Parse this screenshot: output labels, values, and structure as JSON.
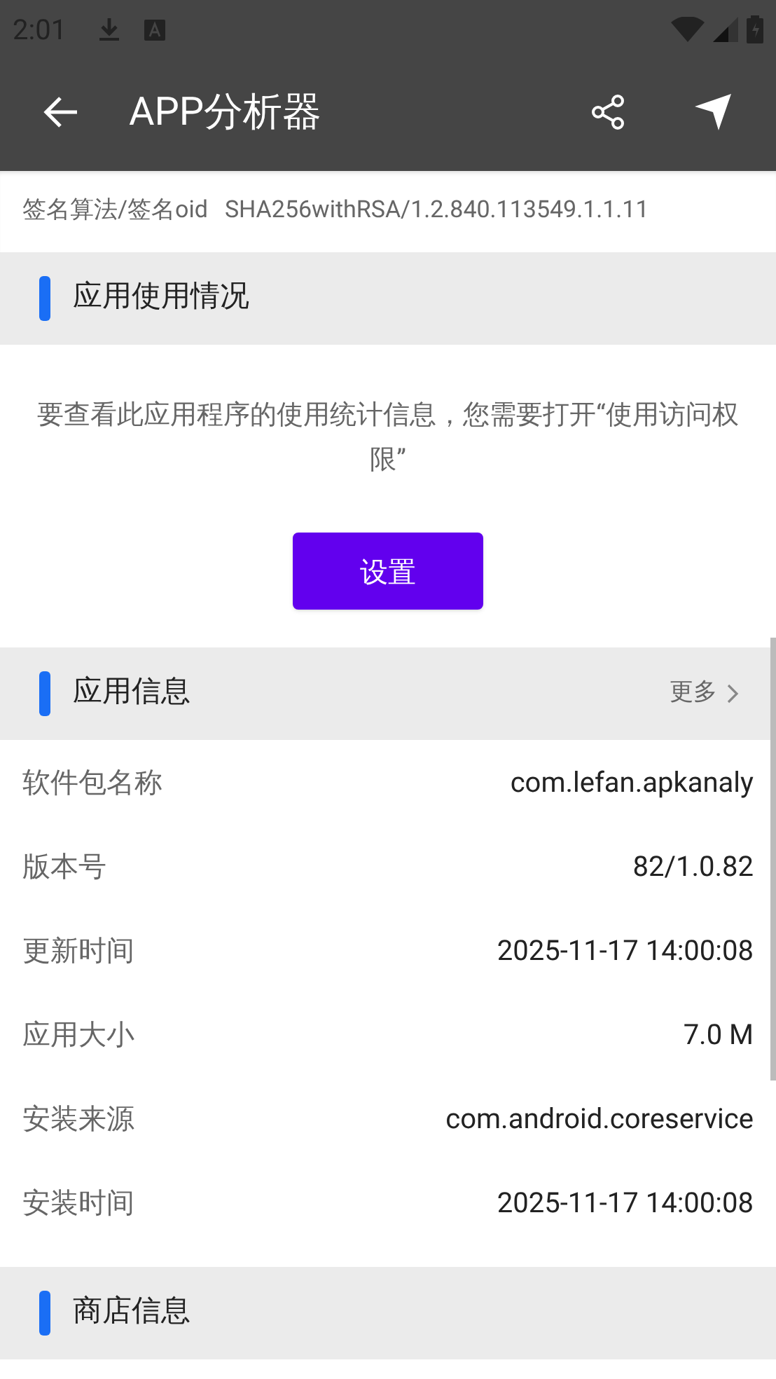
{
  "status_bar": {
    "time": "2:01"
  },
  "app_bar": {
    "title": "APP分析器"
  },
  "signature": {
    "label": "签名算法/签名oid",
    "value": "SHA256withRSA/1.2.840.113549.1.1.11"
  },
  "usage_section": {
    "title": "应用使用情况",
    "message": "要查看此应用程序的使用统计信息，您需要打开“使用访问权限”",
    "button": "设置"
  },
  "info_section": {
    "title": "应用信息",
    "more": "更多",
    "rows": [
      {
        "label": "软件包名称",
        "value": "com.lefan.apkanaly"
      },
      {
        "label": "版本号",
        "value": "82/1.0.82"
      },
      {
        "label": "更新时间",
        "value": "2025-11-17 14:00:08"
      },
      {
        "label": "应用大小",
        "value": "7.0 M"
      },
      {
        "label": "安装来源",
        "value": "com.android.coreservice"
      },
      {
        "label": "安装时间",
        "value": "2025-11-17 14:00:08"
      }
    ]
  },
  "store_section": {
    "title": "商店信息"
  }
}
